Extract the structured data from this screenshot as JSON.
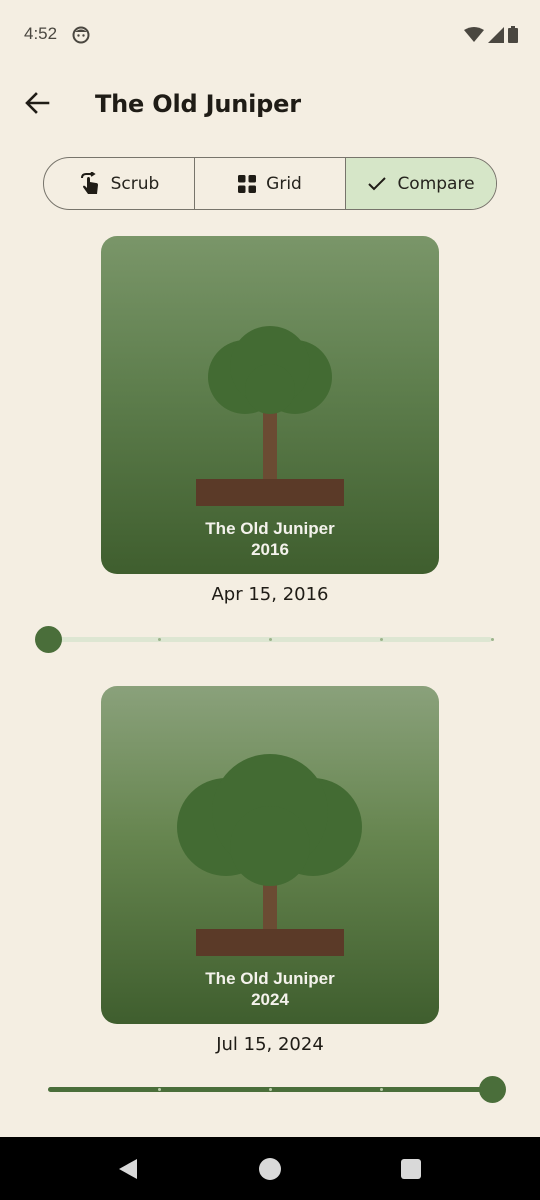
{
  "status_bar": {
    "time": "4:52",
    "icons": [
      "notification-face-icon",
      "wifi-icon",
      "signal-icon",
      "battery-icon"
    ]
  },
  "app_bar": {
    "title": "The Old Juniper",
    "back_icon": "arrow-back-icon"
  },
  "view_toggle": {
    "options": [
      {
        "label": "Scrub",
        "icon": "touch-swipe-icon",
        "selected": false
      },
      {
        "label": "Grid",
        "icon": "grid-icon",
        "selected": false
      },
      {
        "label": "Compare",
        "icon": "check-icon",
        "selected": true
      }
    ]
  },
  "compare": {
    "top": {
      "caption_name": "The Old Juniper",
      "caption_year": "2016",
      "date": "Apr 15, 2016",
      "slider_index": 0,
      "slider_steps": 5
    },
    "bottom": {
      "caption_name": "The Old Juniper",
      "caption_year": "2024",
      "date": "Jul 15, 2024",
      "slider_index": 4,
      "slider_steps": 5
    }
  },
  "colors": {
    "background": "#f4eee2",
    "accent": "#4a6e3a",
    "selected_segment": "#d6e6c8",
    "foliage": "#436b33",
    "trunk": "#6b4b33",
    "pot": "#5b3a28"
  },
  "nav_bar": {
    "buttons": [
      "back-triangle-icon",
      "home-circle-icon",
      "recents-square-icon"
    ]
  }
}
